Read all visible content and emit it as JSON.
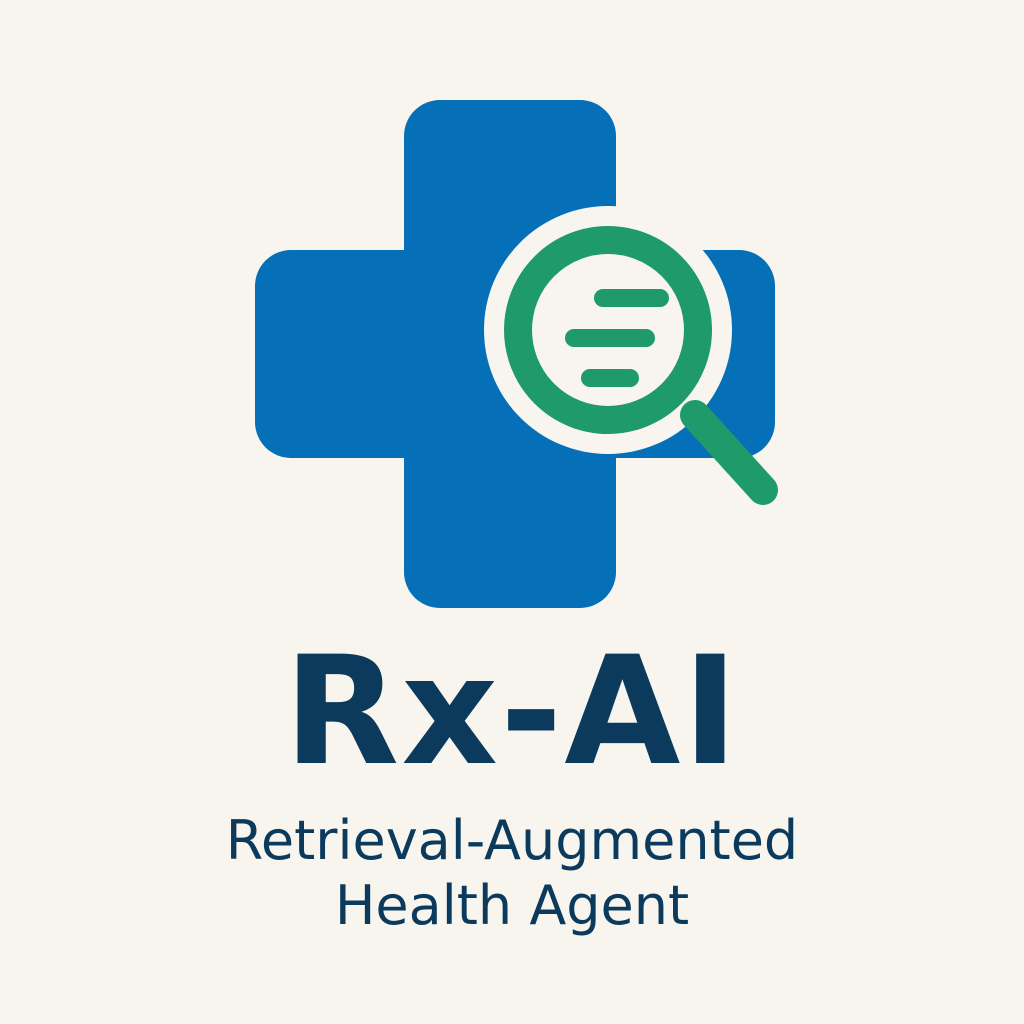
{
  "brand": {
    "name": "Rx-AI",
    "tagline_line1": "Retrieval-Augmented",
    "tagline_line2": "Health Agent"
  },
  "icons": {
    "cross": "medical-cross-icon",
    "magnifier": "magnifying-glass-icon"
  },
  "colors": {
    "background": "#f8f5ef",
    "cross_blue": "#0570b8",
    "magnifier_green": "#1f9a6a",
    "text_navy": "#0b3a5c"
  }
}
